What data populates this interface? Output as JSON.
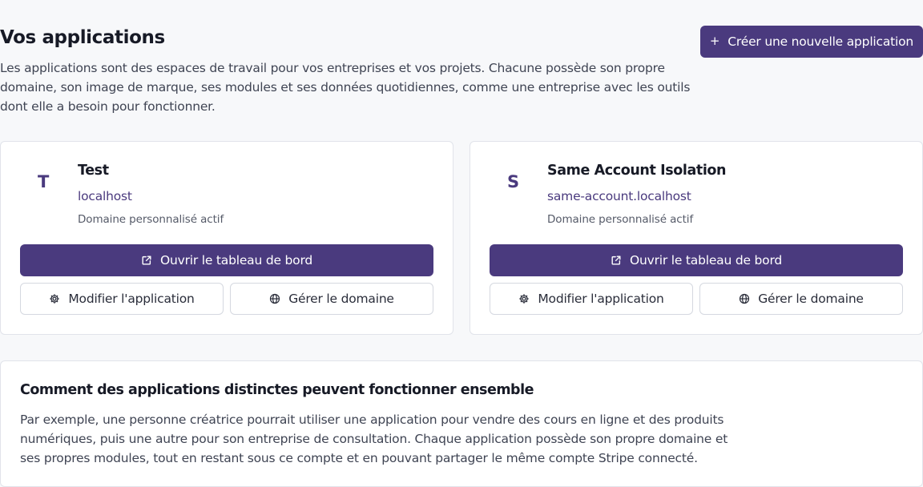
{
  "header": {
    "title": "Vos applications",
    "description": "Les applications sont des espaces de travail pour vos entreprises et vos projets. Chacune possède son propre domaine, son image de marque, ses modules et ses données quotidiennes, comme une entreprise avec les outils dont elle a besoin pour fonctionner.",
    "create_button": "Créer une nouvelle application",
    "create_icon": "plus-icon"
  },
  "apps": [
    {
      "initial": "T",
      "name": "Test",
      "domain": "localhost",
      "status": "Domaine personnalisé actif",
      "open_label": "Ouvrir le tableau de bord",
      "edit_label": "Modifier l'application",
      "domain_label": "Gérer le domaine"
    },
    {
      "initial": "S",
      "name": "Same Account Isolation",
      "domain": "same-account.localhost",
      "status": "Domaine personnalisé actif",
      "open_label": "Ouvrir le tableau de bord",
      "edit_label": "Modifier l'application",
      "domain_label": "Gérer le domaine"
    }
  ],
  "info": {
    "title": "Comment des applications distinctes peuvent fonctionner ensemble",
    "text": "Par exemple, une personne créatrice pourrait utiliser une application pour vendre des cours en ligne et des produits numériques, puis une autre pour son entreprise de consultation. Chaque application possède son propre domaine et ses propres modules, tout en restant sous ce compte et en pouvant partager le même compte Stripe connecté."
  },
  "colors": {
    "accent": "#4a3a7e",
    "background": "#f7f8fa",
    "card": "#ffffff",
    "border": "#e1e3ea"
  }
}
